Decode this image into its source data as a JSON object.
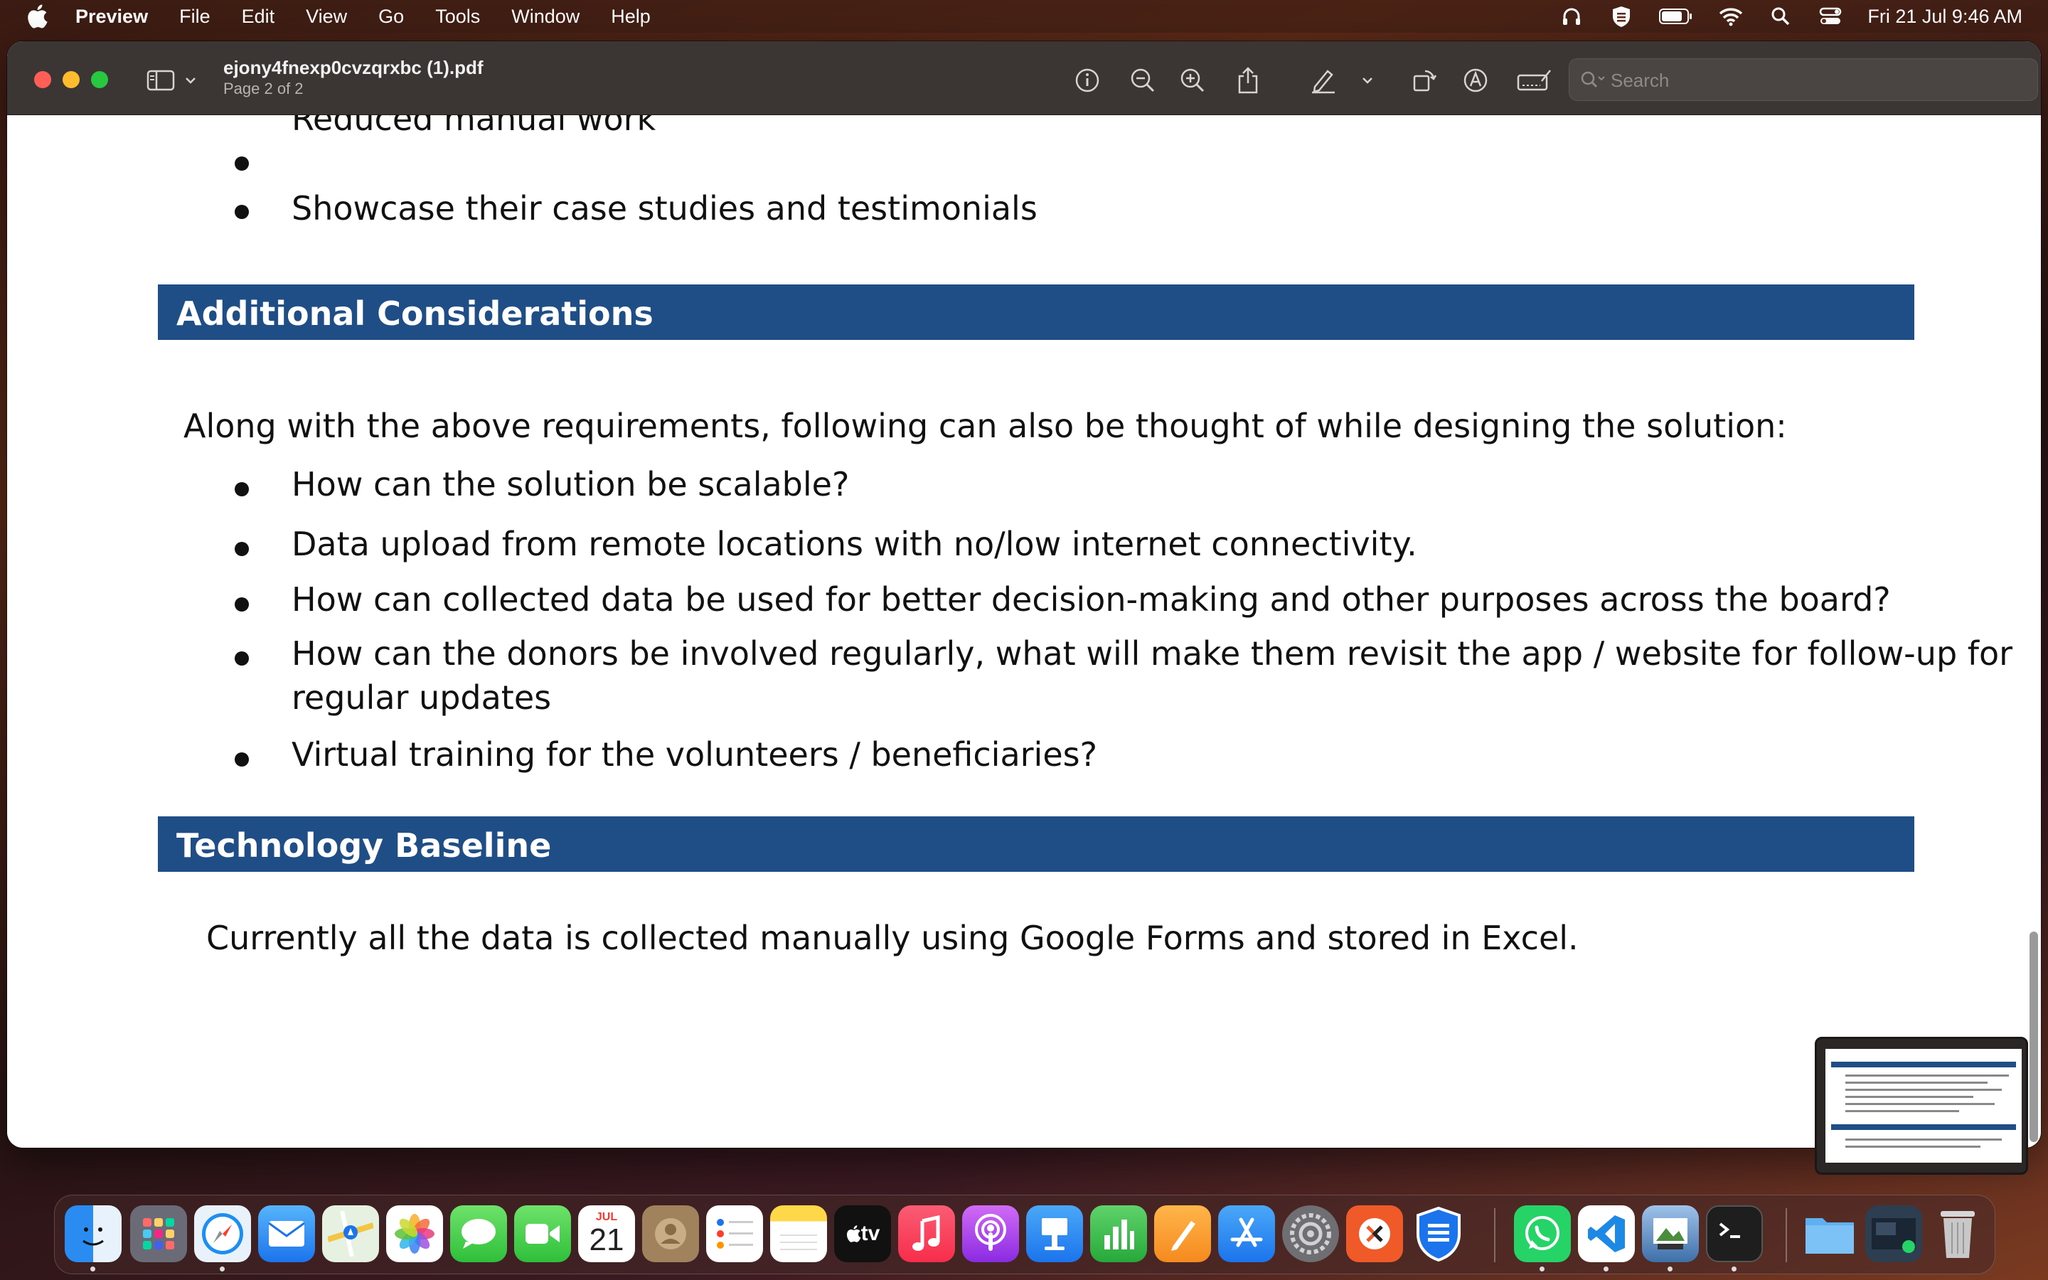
{
  "menubar": {
    "app_name": "Preview",
    "items": [
      "File",
      "Edit",
      "View",
      "Go",
      "Tools",
      "Window",
      "Help"
    ],
    "clock": "Fri 21 Jul  9:46 AM"
  },
  "window": {
    "title": "ejony4fnexp0cvzqrxbc (1).pdf",
    "subtitle": "Page 2 of 2",
    "search_placeholder": "Search"
  },
  "document": {
    "top_partial_bullet": "Reduced manual work",
    "top_bullet": "Showcase their case studies and testimonials",
    "section1_heading": "Additional Considerations",
    "section1_intro": "Along with the above requirements, following can also be thought of while designing the solution:",
    "section1_bullets": [
      "How can the solution be scalable?",
      "Data upload from remote locations with no/low internet connectivity.",
      "How can collected data be used for better decision-making and other purposes across the board?",
      "How can the donors be involved regularly, what will make them revisit the app / website for follow-up for",
      "regular updates",
      "Virtual training for the volunteers / beneficiaries?"
    ],
    "section2_heading": "Technology Baseline",
    "section2_text": "Currently all the data is collected manually using Google Forms and stored in Excel."
  },
  "dock": {
    "calendar_month": "JUL",
    "calendar_day": "21",
    "tv_label": "tv"
  },
  "colors": {
    "section_bar": "#1f4e86",
    "titlebar": "#3b3533"
  }
}
